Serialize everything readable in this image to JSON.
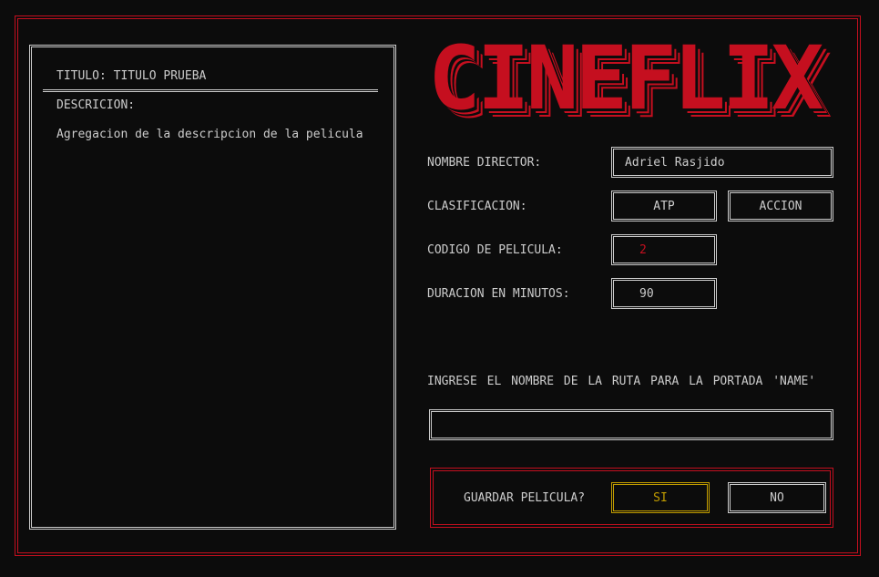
{
  "sidebar": {
    "title_line": "TITULO: TITULO PRUEBA",
    "description_label": "DESCRICION:",
    "description_text": "Agregacion de la descripcion de la pelicula"
  },
  "logo": {
    "text": "CINEFLIX",
    "color": "#c50f1f"
  },
  "form": {
    "director_label": "NOMBRE DIRECTOR:",
    "director_value": "Adriel Rasjido",
    "classification_label": "CLASIFICACION:",
    "classification_value": "ATP",
    "genre_value": "ACCION",
    "code_label": "CODIGO DE PELICULA:",
    "code_value": "2",
    "duration_label": "DURACION EN MINUTOS:",
    "duration_value": "90",
    "cover_path_label": "INGRESE EL NOMBRE DE LA RUTA PARA LA PORTADA 'NAME'",
    "cover_path_value": ""
  },
  "save": {
    "prompt": "GUARDAR PELICULA?",
    "yes_label": "SI",
    "no_label": "NO"
  },
  "colors": {
    "accent": "#c50f1f",
    "highlight": "#c19c00",
    "text": "#cccccc",
    "background": "#0c0c0c"
  }
}
